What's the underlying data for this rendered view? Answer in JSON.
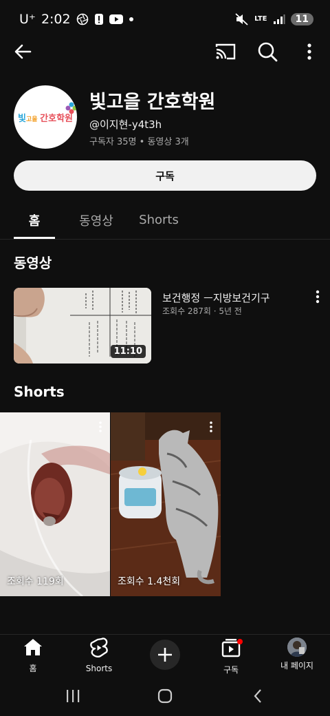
{
  "status_bar": {
    "carrier": "U⁺",
    "time": "2:02",
    "network": "LTE",
    "battery": "11"
  },
  "channel": {
    "name": "빛고을 간호학원",
    "handle": "@이지현-y4t3h",
    "stats": "구독자 35명 • 동영상 3개",
    "avatar_text_main": "빛",
    "avatar_text_small": "고을",
    "avatar_text_accent": "간호학원"
  },
  "subscribe_label": "구독",
  "tabs": [
    {
      "label": "홈",
      "active": true
    },
    {
      "label": "동영상",
      "active": false
    },
    {
      "label": "Shorts",
      "active": false
    }
  ],
  "sections": {
    "videos_title": "동영상",
    "shorts_title": "Shorts"
  },
  "videos": [
    {
      "title": "보건행정 ㅡ지방보건기구",
      "meta": "조회수 287회 · 5년 전",
      "duration": "11:10"
    }
  ],
  "shorts": [
    {
      "views": "조회수 119회"
    },
    {
      "views": "조회수 1.4천회"
    }
  ],
  "bottom_nav": [
    {
      "label": "홈",
      "icon": "home-icon"
    },
    {
      "label": "Shorts",
      "icon": "shorts-icon"
    },
    {
      "label": "",
      "icon": "create-icon"
    },
    {
      "label": "구독",
      "icon": "subscriptions-icon"
    },
    {
      "label": "내 페이지",
      "icon": "avatar"
    }
  ],
  "colors": {
    "background": "#0f0f0f",
    "subscribe_bg": "#f1f1f1",
    "notification_dot": "#ff0000"
  }
}
